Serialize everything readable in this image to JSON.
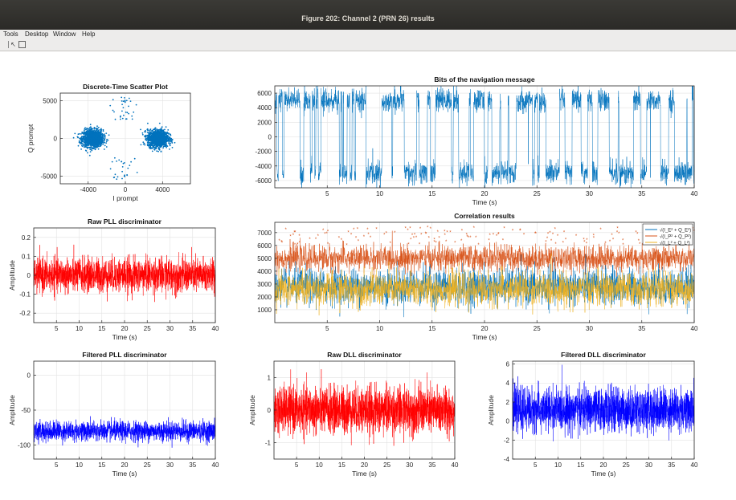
{
  "window": {
    "title": "Figure 202: Channel 2 (PRN 26) results"
  },
  "menu": {
    "items": [
      "Tools",
      "Desktop",
      "Window",
      "Help"
    ]
  },
  "toolbar": {
    "icons": [
      "toggle-icon",
      "pointer-icon",
      "layout-icon"
    ]
  },
  "colors": {
    "scatter": "#0072bd",
    "nav": "#0072bd",
    "raw_pll": "#ff0000",
    "filtered_pll": "#0000ff",
    "raw_dll": "#ff0000",
    "filtered_dll": "#0000ff",
    "corr_early": "#0072bd",
    "corr_prompt": "#d95319",
    "corr_late": "#edb120"
  },
  "chart_data": [
    {
      "id": "scatter",
      "type": "scatter",
      "title": "Discrete-Time Scatter Plot",
      "xlabel": "I prompt",
      "ylabel": "Q prompt",
      "xlim": [
        -7000,
        7000
      ],
      "ylim": [
        -6000,
        6000
      ],
      "xticks": [
        -4000,
        0,
        4000
      ],
      "yticks": [
        -5000,
        0,
        5000
      ],
      "clusters": [
        {
          "center": [
            -3500,
            0
          ],
          "spread": [
            1000,
            700
          ]
        },
        {
          "center": [
            3500,
            0
          ],
          "spread": [
            1000,
            700
          ]
        }
      ],
      "grid": true
    },
    {
      "id": "nav",
      "type": "line",
      "title": "Bits of the navigation message",
      "xlabel": "Time (s)",
      "ylabel": "",
      "xlim": [
        0,
        40
      ],
      "ylim": [
        -7000,
        7000
      ],
      "xticks": [
        5,
        10,
        15,
        20,
        25,
        30,
        35,
        40
      ],
      "yticks": [
        -6000,
        -4000,
        -2000,
        0,
        2000,
        4000,
        6000
      ],
      "levels": [
        5000,
        -5000
      ],
      "noise": 800,
      "grid": true
    },
    {
      "id": "raw_pll",
      "type": "line",
      "title": "Raw PLL discriminator",
      "xlabel": "Time (s)",
      "ylabel": "Amplitude",
      "xlim": [
        0,
        40
      ],
      "ylim": [
        -0.25,
        0.25
      ],
      "xticks": [
        5,
        10,
        15,
        20,
        25,
        30,
        35,
        40
      ],
      "yticks": [
        -0.2,
        -0.1,
        0,
        0.1,
        0.2
      ],
      "mean": 0.0,
      "noise": 0.045,
      "grid": true
    },
    {
      "id": "corr",
      "type": "line",
      "title": "Correlation results",
      "xlabel": "Time (s)",
      "ylabel": "",
      "xlim": [
        0,
        40
      ],
      "ylim": [
        0,
        7800
      ],
      "xticks": [
        5,
        10,
        15,
        20,
        25,
        30,
        35,
        40
      ],
      "yticks": [
        1000,
        2000,
        3000,
        4000,
        5000,
        6000,
        7000
      ],
      "series": [
        {
          "name": "√(I_E² + Q_E²)",
          "mean": 2800,
          "noise": 700
        },
        {
          "name": "√(I_P² + Q_P²)",
          "mean": 5000,
          "noise": 500
        },
        {
          "name": "√(I_L² + Q_L²)",
          "mean": 2600,
          "noise": 650
        }
      ],
      "legend": "top-right",
      "grid": true
    },
    {
      "id": "filtered_pll",
      "type": "line",
      "title": "Filtered PLL discriminator",
      "xlabel": "Time (s)",
      "ylabel": "Amplitude",
      "xlim": [
        0,
        40
      ],
      "ylim": [
        -120,
        20
      ],
      "xticks": [
        5,
        10,
        15,
        20,
        25,
        30,
        35,
        40
      ],
      "yticks": [
        -100,
        -50,
        0
      ],
      "mean": -80,
      "noise": 7,
      "grid": true
    },
    {
      "id": "raw_dll",
      "type": "line",
      "title": "Raw DLL discriminator",
      "xlabel": "Time (s)",
      "ylabel": "Amplitude",
      "xlim": [
        0,
        40
      ],
      "ylim": [
        -1.5,
        1.5
      ],
      "xticks": [
        5,
        10,
        15,
        20,
        25,
        30,
        35,
        40
      ],
      "yticks": [
        -1,
        0,
        1
      ],
      "mean": 0,
      "noise": 0.35,
      "grid": true
    },
    {
      "id": "filtered_dll",
      "type": "line",
      "title": "Filtered DLL discriminator",
      "xlabel": "Time (s)",
      "ylabel": "Amplitude",
      "xlim": [
        0,
        40
      ],
      "ylim": [
        -4,
        6.3
      ],
      "xticks": [
        5,
        10,
        15,
        20,
        25,
        30,
        35,
        40
      ],
      "yticks": [
        -4,
        -2,
        0,
        2,
        4,
        6
      ],
      "mean": 1.2,
      "noise": 1.1,
      "grid": true
    }
  ]
}
